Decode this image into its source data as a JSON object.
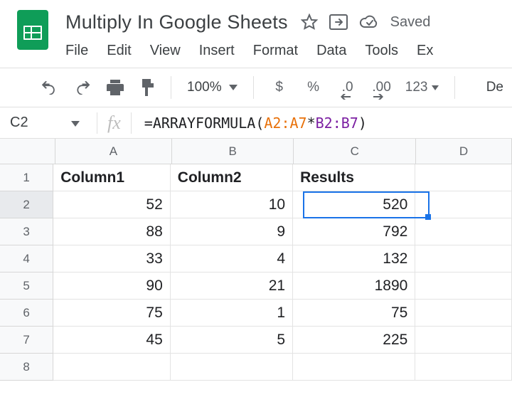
{
  "document": {
    "title": "Multiply In Google Sheets",
    "saved_label": "Saved"
  },
  "menus": {
    "file": "File",
    "edit": "Edit",
    "view": "View",
    "insert": "Insert",
    "format": "Format",
    "data": "Data",
    "tools": "Tools",
    "ex": "Ex"
  },
  "toolbar": {
    "zoom": "100%",
    "currency": "$",
    "percent": "%",
    "dec_dec": ".0",
    "inc_dec": ".00",
    "more_formats": "123",
    "font": "De"
  },
  "namebox": {
    "ref": "C2"
  },
  "formula": {
    "raw": "=ARRAYFORMULA(A2:A7*B2:B7)",
    "eq": "=",
    "func": "ARRAYFORMULA",
    "lparen": "(",
    "rangeA": "A2:A7",
    "op": "*",
    "rangeB": "B2:B7",
    "rparen": ")"
  },
  "columns": {
    "a": "A",
    "b": "B",
    "c": "C",
    "d": "D"
  },
  "headers": {
    "col1": "Column1",
    "col2": "Column2",
    "col3": "Results"
  },
  "rows": [
    {
      "n": "1"
    },
    {
      "n": "2",
      "a": "52",
      "b": "10",
      "c": "520"
    },
    {
      "n": "3",
      "a": "88",
      "b": "9",
      "c": "792"
    },
    {
      "n": "4",
      "a": "33",
      "b": "4",
      "c": "132"
    },
    {
      "n": "5",
      "a": "90",
      "b": "21",
      "c": "1890"
    },
    {
      "n": "6",
      "a": "75",
      "b": "1",
      "c": "75"
    },
    {
      "n": "7",
      "a": "45",
      "b": "5",
      "c": "225"
    },
    {
      "n": "8"
    }
  ],
  "selection": {
    "cell": "C2"
  },
  "chart_data": {
    "type": "table",
    "title": "Multiply In Google Sheets",
    "columns": [
      "Column1",
      "Column2",
      "Results"
    ],
    "data": [
      [
        52,
        10,
        520
      ],
      [
        88,
        9,
        792
      ],
      [
        33,
        4,
        132
      ],
      [
        90,
        21,
        1890
      ],
      [
        75,
        1,
        75
      ],
      [
        45,
        5,
        225
      ]
    ],
    "formula": "=ARRAYFORMULA(A2:A7*B2:B7)"
  }
}
